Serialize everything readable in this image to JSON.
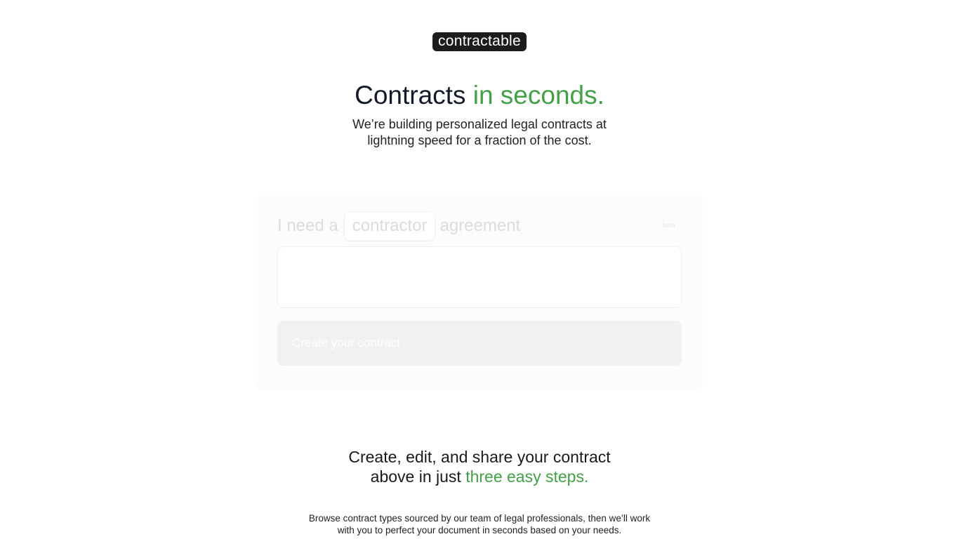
{
  "logo": {
    "text": "contractable",
    "bg_color": "#1c1c1c"
  },
  "hero": {
    "title_main": "Contracts",
    "title_accent": "in seconds.",
    "subtitle": "We’re building personalized legal contracts at lightning speed for a fraction of the cost."
  },
  "form": {
    "prefix": "I need a",
    "contract_type": "contractor",
    "suffix": "agreement",
    "beta_badge": "beta",
    "details_placeholder": "",
    "create_button": "Create your contract"
  },
  "steps": {
    "title_main": "Create, edit, and share your contract above in just",
    "title_accent": "three easy steps.",
    "description": "Browse contract types sourced by our team of legal professionals, then we’ll work with you to perfect your document in seconds based on your needs."
  },
  "colors": {
    "accent": "#44a047",
    "heading": "#131a2b",
    "muted_text": "#dcdcdc",
    "button_bg": "#f1f1f1"
  }
}
